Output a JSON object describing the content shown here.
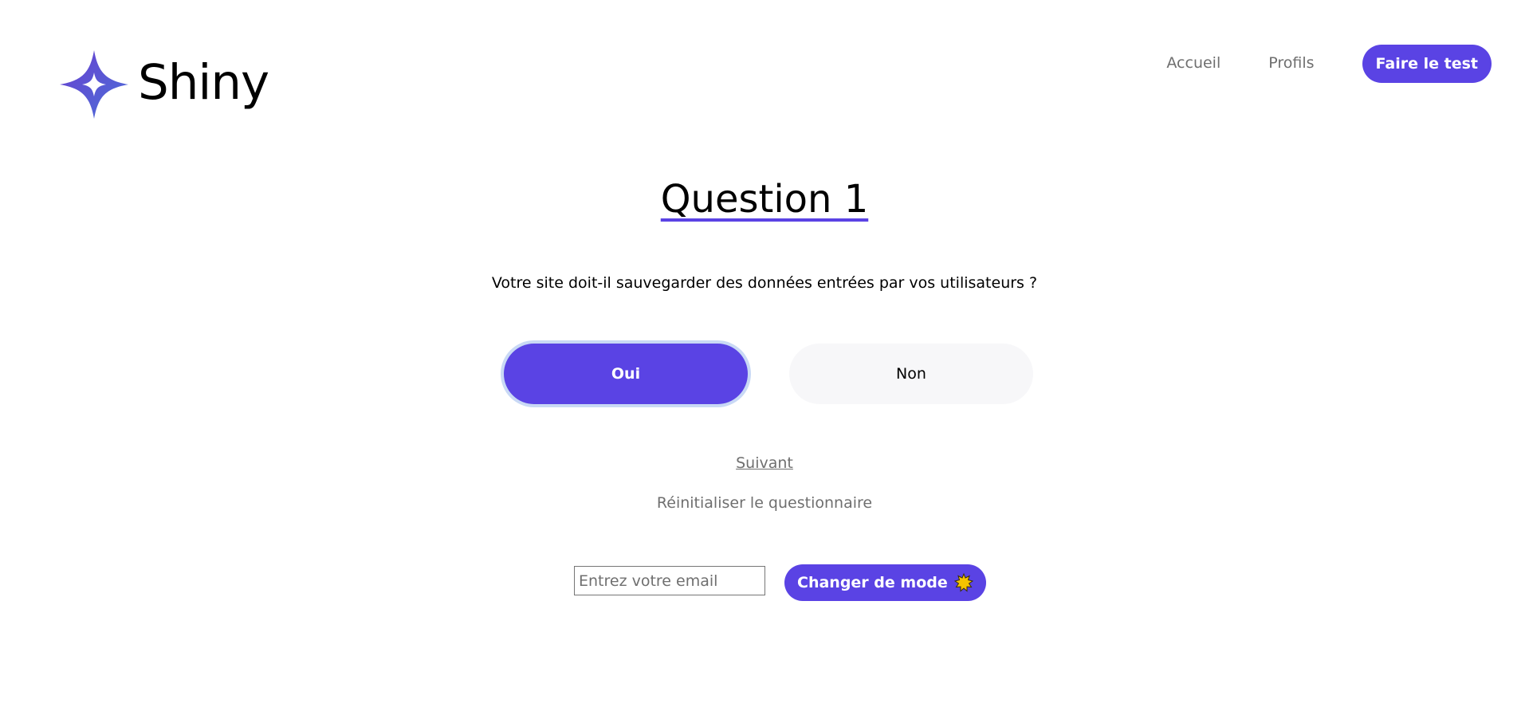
{
  "header": {
    "logo_text": "Shiny",
    "nav": {
      "home": "Accueil",
      "profiles": "Profils",
      "cta": "Faire le test"
    }
  },
  "survey": {
    "title": "Question 1",
    "question": "Votre site doit-il sauvegarder des données entrées par vos utilisateurs ?",
    "answers": {
      "yes": "Oui",
      "no": "Non"
    },
    "selected_answer": "Oui",
    "next": "Suivant",
    "reset": "Réinitialiser le questionnaire"
  },
  "footer_controls": {
    "email_placeholder": "Entrez votre email",
    "email_value": "",
    "mode_button": "Changer de mode",
    "mode_icon": "sun-icon"
  },
  "colors": {
    "accent": "#5a43e4",
    "muted_text": "#6f6f6f",
    "focus_ring": "#c9d9f5",
    "secondary_button_bg": "#f7f7f9"
  }
}
